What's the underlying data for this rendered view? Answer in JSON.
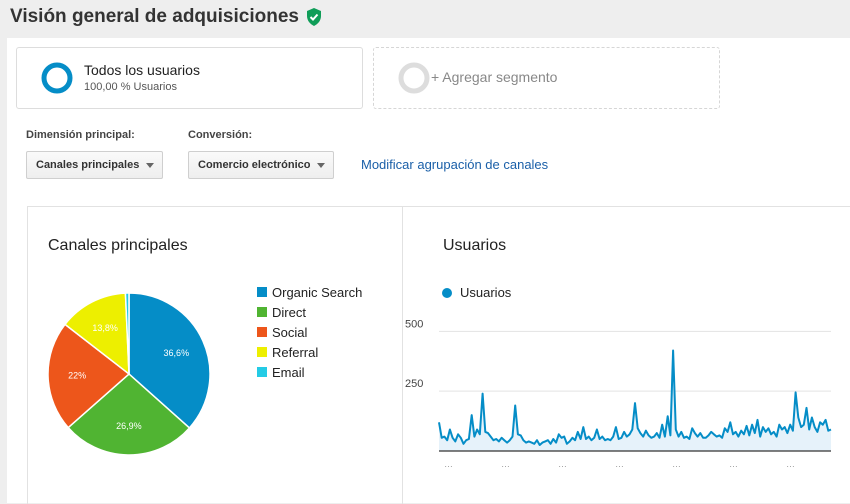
{
  "header": {
    "title": "Visión general de adquisiciones",
    "verified_icon": "shield-check-icon",
    "verified_color": "#0f9d58"
  },
  "segments": [
    {
      "name": "Todos los usuarios",
      "subtitle": "100,00 % Usuarios",
      "ring_color": "#058dc7"
    },
    {
      "add_label": "+ Agregar segmento",
      "ring_color": "#dddddd"
    }
  ],
  "controls": {
    "primary_dimension": {
      "label": "Dimensión principal:",
      "value": "Canales principales"
    },
    "conversion": {
      "label": "Conversión:",
      "value": "Comercio electrónico"
    },
    "edit_link": "Modificar agrupación de canales",
    "link_color": "#1a5fa8"
  },
  "pie_panel": {
    "title": "Canales principales"
  },
  "line_panel": {
    "title": "Usuarios"
  },
  "chart_data": [
    {
      "type": "pie",
      "title": "Canales principales",
      "slices": [
        {
          "name": "Organic Search",
          "value": 36.6,
          "label": "36,6%",
          "color": "#058dc7"
        },
        {
          "name": "Direct",
          "value": 26.9,
          "label": "26,9%",
          "color": "#50b432"
        },
        {
          "name": "Social",
          "value": 22.0,
          "label": "22%",
          "color": "#ed561b"
        },
        {
          "name": "Referral",
          "value": 13.8,
          "label": "13,8%",
          "color": "#edef00"
        },
        {
          "name": "Email",
          "value": 0.7,
          "label": "",
          "color": "#24cbe5"
        }
      ],
      "legend": "right"
    },
    {
      "type": "area",
      "title": "Usuarios",
      "series": [
        {
          "name": "Usuarios",
          "color": "#058dc7",
          "fill": "#e6f2fa",
          "values": [
            120,
            55,
            60,
            45,
            90,
            55,
            40,
            70,
            55,
            30,
            45,
            50,
            150,
            60,
            90,
            70,
            240,
            80,
            75,
            60,
            45,
            50,
            40,
            55,
            45,
            35,
            45,
            60,
            190,
            70,
            65,
            45,
            35,
            40,
            35,
            30,
            45,
            25,
            35,
            40,
            45,
            30,
            50,
            35,
            70,
            55,
            60,
            30,
            40,
            55,
            45,
            80,
            50,
            100,
            50,
            60,
            45,
            55,
            90,
            50,
            60,
            45,
            50,
            45,
            60,
            100,
            50,
            55,
            80,
            60,
            70,
            90,
            200,
            95,
            75,
            60,
            85,
            65,
            55,
            60,
            75,
            55,
            110,
            60,
            145,
            65,
            420,
            90,
            60,
            80,
            55,
            60,
            50,
            95,
            75,
            60,
            75,
            55,
            55,
            65,
            80,
            70,
            60,
            65,
            55,
            95,
            80,
            120,
            70,
            80,
            60,
            85,
            70,
            105,
            65,
            110,
            75,
            130,
            60,
            100,
            80,
            95,
            70,
            80,
            60,
            110,
            90,
            100,
            75,
            110,
            85,
            245,
            140,
            100,
            110,
            180,
            90,
            140,
            100,
            80,
            120,
            110,
            130,
            85,
            90
          ]
        }
      ],
      "y_ticks": [
        250,
        500
      ],
      "ylim": [
        0,
        560
      ],
      "grid": true,
      "legend": "top-left"
    }
  ]
}
